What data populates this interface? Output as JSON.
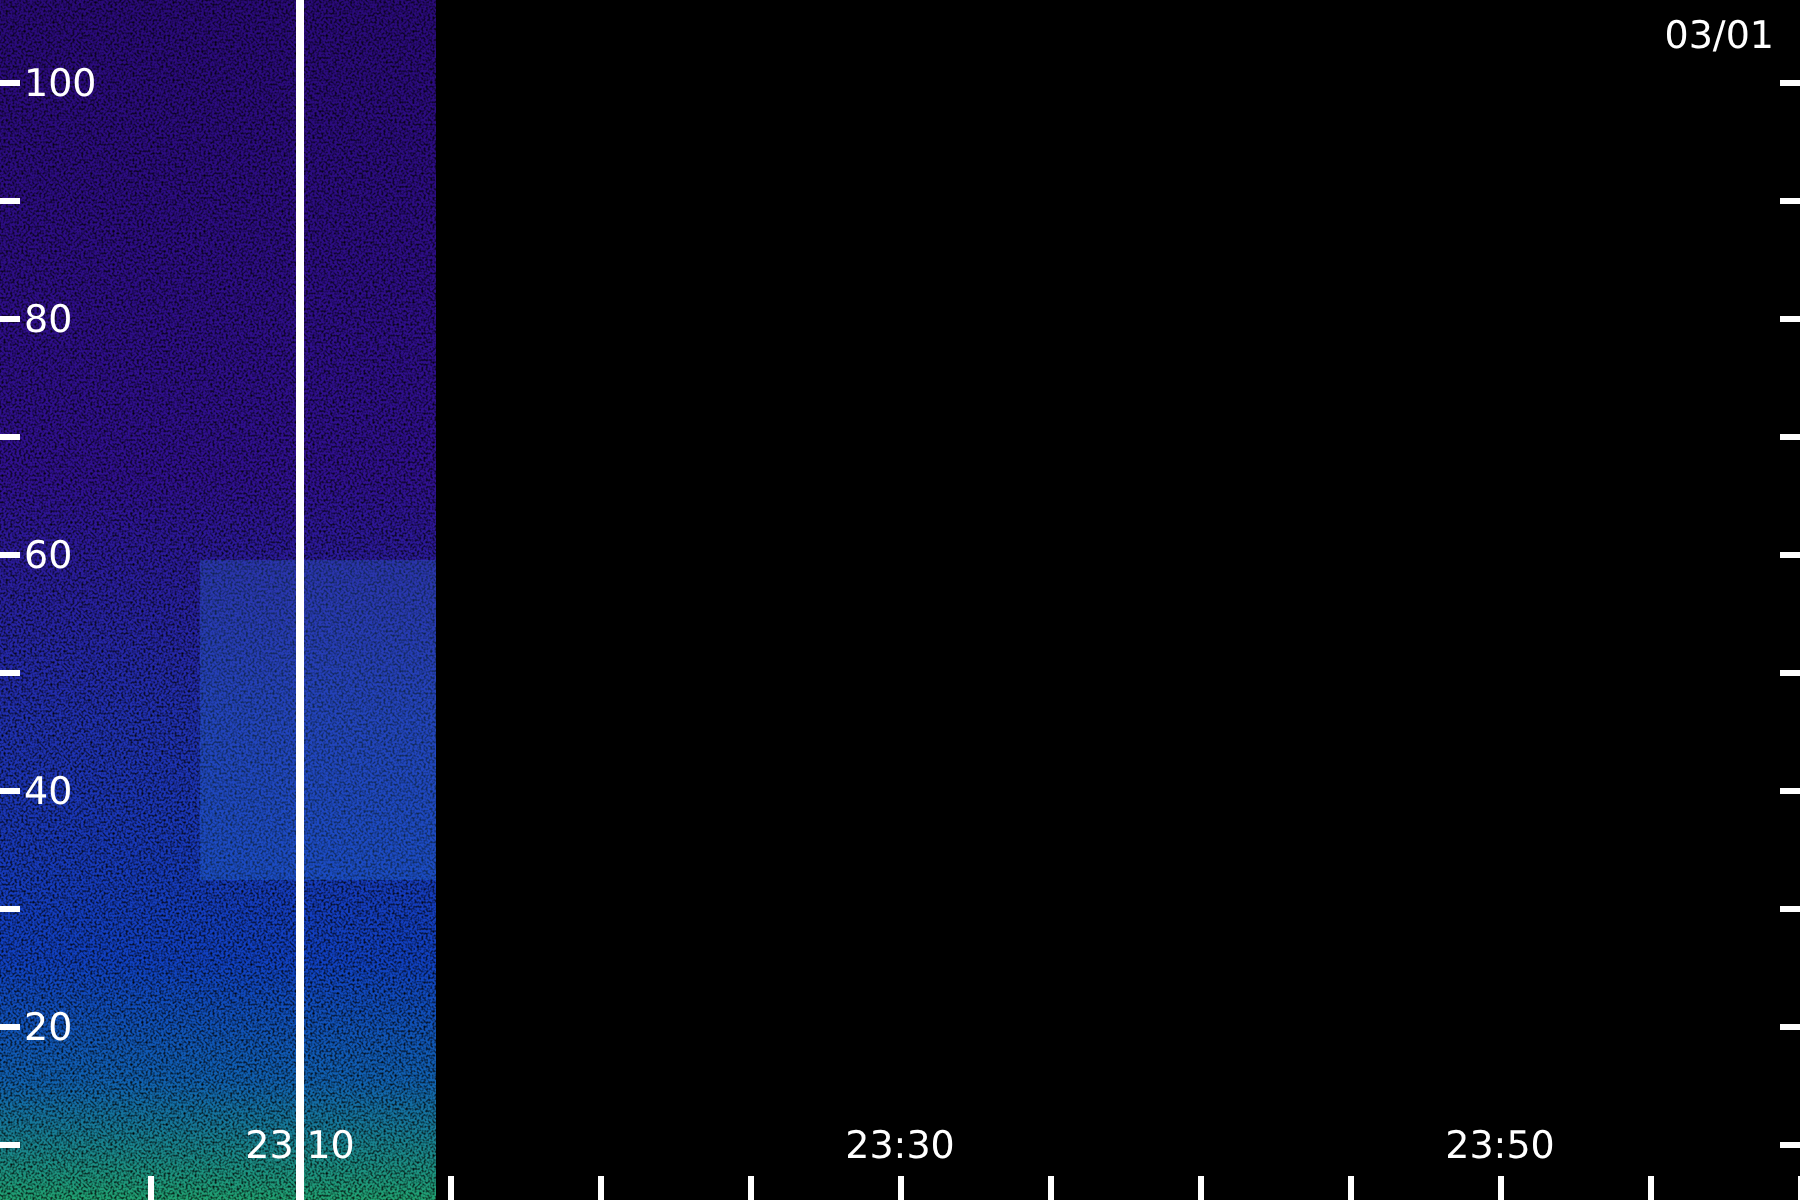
{
  "plot": {
    "date": "03/01",
    "y_labels": [
      "100",
      "80",
      "60",
      "40",
      "20"
    ],
    "x_labels": [
      "23:10",
      "23:30",
      "23:50"
    ]
  }
}
